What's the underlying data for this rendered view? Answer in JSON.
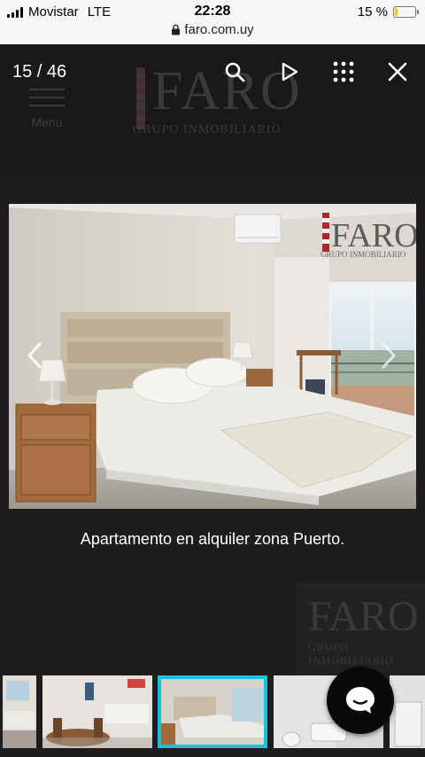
{
  "status_bar": {
    "carrier": "Movistar",
    "network": "LTE",
    "time": "22:28",
    "battery_text": "15 %",
    "battery_level": 0.15,
    "url": "faro.com.uy"
  },
  "background": {
    "menu_label": "Menu",
    "logo_word": "FARO",
    "logo_sub": "GRUPO INMOBILIARIO"
  },
  "lightbox": {
    "counter": "15 / 46",
    "toolbar_icons": [
      "search-icon",
      "play-icon",
      "grid-icon",
      "close-icon"
    ],
    "image_watermark_word": "FARO",
    "image_watermark_sub": "GRUPO INMOBILIARIO",
    "caption": "Apartamento en alquiler zona Puerto.",
    "thumbnails_count_visible": 6,
    "active_thumbnail_index": 2
  },
  "colors": {
    "accent": "#1cc1d6",
    "battery": "#f2c418",
    "overlay": "#1d1d1f"
  }
}
